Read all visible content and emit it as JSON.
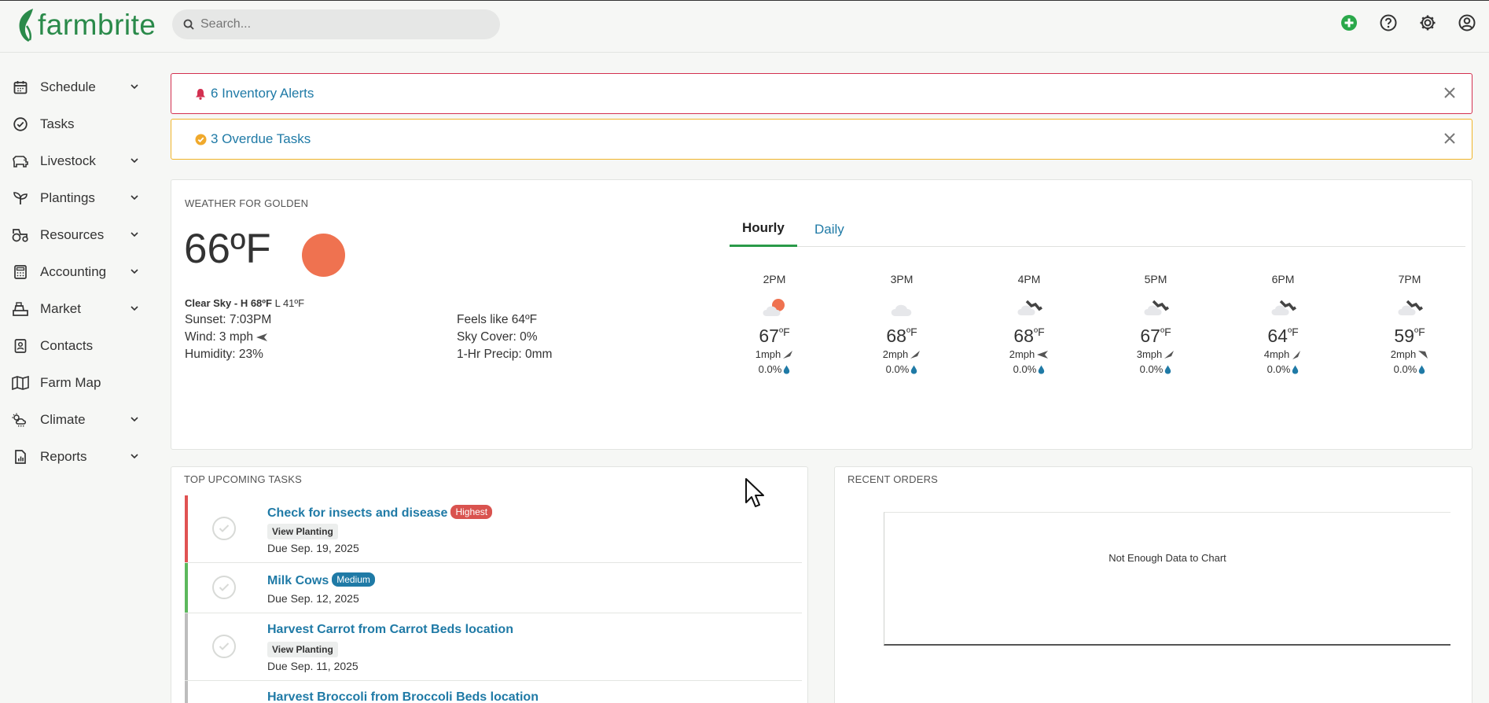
{
  "brand": {
    "name": "farmbrite",
    "color": "#2a8a4a"
  },
  "search": {
    "placeholder": "Search..."
  },
  "top_icons": [
    "add-icon",
    "help-icon",
    "gear-icon",
    "account-icon"
  ],
  "sidebar": {
    "items": [
      {
        "label": "Schedule",
        "icon": "calendar-icon",
        "expandable": true
      },
      {
        "label": "Tasks",
        "icon": "check-circle-icon",
        "expandable": false
      },
      {
        "label": "Livestock",
        "icon": "livestock-icon",
        "expandable": true
      },
      {
        "label": "Plantings",
        "icon": "sprout-icon",
        "expandable": true
      },
      {
        "label": "Resources",
        "icon": "tractor-icon",
        "expandable": true
      },
      {
        "label": "Accounting",
        "icon": "calculator-icon",
        "expandable": true
      },
      {
        "label": "Market",
        "icon": "register-icon",
        "expandable": true
      },
      {
        "label": "Contacts",
        "icon": "contact-card-icon",
        "expandable": false
      },
      {
        "label": "Farm Map",
        "icon": "map-icon",
        "expandable": false
      },
      {
        "label": "Climate",
        "icon": "cloud-sun-icon",
        "expandable": true
      },
      {
        "label": "Reports",
        "icon": "report-icon",
        "expandable": true
      }
    ]
  },
  "alerts": {
    "inventory": {
      "text": "6 Inventory Alerts",
      "color": "#d33050"
    },
    "overdue": {
      "text": "3 Overdue Tasks",
      "color": "#f0b429"
    }
  },
  "weather": {
    "title": "WEATHER FOR GOLDEN",
    "temp": "66ºF",
    "summary_label": "Clear Sky - H 68ºF",
    "summary_low": "L 41ºF",
    "sunset": "Sunset: 7:03PM",
    "wind": "Wind: 3 mph",
    "humidity": "Humidity: 23%",
    "feels_like": "Feels like 64ºF",
    "sky_cover": "Sky Cover: 0%",
    "precip": "1-Hr Precip: 0mm",
    "tabs": {
      "hourly": "Hourly",
      "daily": "Daily"
    },
    "hours": [
      {
        "time": "2PM",
        "temp": "67",
        "unit": "ºF",
        "wind": "1mph",
        "precip": "0.0%",
        "icon": "partly-sunny-icon"
      },
      {
        "time": "3PM",
        "temp": "68",
        "unit": "ºF",
        "wind": "2mph",
        "precip": "0.0%",
        "icon": "cloud-icon"
      },
      {
        "time": "4PM",
        "temp": "68",
        "unit": "ºF",
        "wind": "2mph",
        "precip": "0.0%",
        "icon": "windy-cloud-icon"
      },
      {
        "time": "5PM",
        "temp": "67",
        "unit": "ºF",
        "wind": "3mph",
        "precip": "0.0%",
        "icon": "windy-cloud-icon"
      },
      {
        "time": "6PM",
        "temp": "64",
        "unit": "ºF",
        "wind": "4mph",
        "precip": "0.0%",
        "icon": "windy-cloud-icon"
      },
      {
        "time": "7PM",
        "temp": "59",
        "unit": "ºF",
        "wind": "2mph",
        "precip": "0.0%",
        "icon": "windy-cloud-icon"
      }
    ]
  },
  "tasks": {
    "title": "TOP UPCOMING TASKS",
    "items": [
      {
        "name": "Check for insects and disease",
        "priority": "Highest",
        "priority_color": "#d9534f",
        "bar_color": "#e05252",
        "view_planting": "View Planting",
        "due": "Due Sep. 19, 2025"
      },
      {
        "name": "Milk Cows",
        "priority": "Medium",
        "priority_color": "#1f7aa6",
        "bar_color": "#5cb85c",
        "view_planting": "",
        "due": "Due Sep. 12, 2025"
      },
      {
        "name": "Harvest Carrot from Carrot Beds location",
        "priority": "",
        "priority_color": "",
        "bar_color": "#bdbdbd",
        "view_planting": "View Planting",
        "due": "Due Sep. 11, 2025"
      },
      {
        "name": "Harvest Broccoli from Broccoli Beds location",
        "priority": "",
        "priority_color": "",
        "bar_color": "#bdbdbd",
        "view_planting": "",
        "due": ""
      }
    ]
  },
  "orders": {
    "title": "RECENT ORDERS",
    "empty_text": "Not Enough Data to Chart"
  }
}
